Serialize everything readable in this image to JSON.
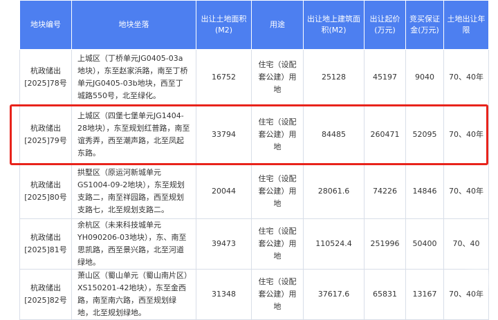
{
  "headers": [
    "地块编号",
    "地块坐落",
    "出让土地面积(M2)",
    "用途",
    "出让地上建筑面积(M2)",
    "出让起价(万元)",
    "竞买保证金(万元)",
    "土地出让年限"
  ],
  "rows": [
    {
      "id": "杭政储出[2025]78号",
      "location": "上城区（丁桥单元JG0405-03a地块），东至赵家浜路，南至丁桥单元JG0405-03b地块，西至丁城路550号，北至绿化。",
      "area": "16752",
      "usage": "住宅（设配套公建）用地",
      "building_area": "25128",
      "start_price": "45197",
      "deposit": "9040",
      "term": "70、40年"
    },
    {
      "id": "杭政储出[2025]79号",
      "location": "上城区（四堡七堡单元JG1404-28地块），东至规划红普路，南至谊秀弄，西至潮声路，北至凤起东路。",
      "area": "33794",
      "usage": "住宅（设配套公建）用地",
      "building_area": "84485",
      "start_price": "260471",
      "deposit": "52095",
      "term": "70、40年"
    },
    {
      "id": "杭政储出[2025]80号",
      "location": "拱墅区（原运河新城单元GS1004-09-2地块），东至规划支路二，南至祥园路，西至规划支路七，北至规划支路二。",
      "area": "20044",
      "usage": "住宅（设配套公建）用地",
      "building_area": "28061.6",
      "start_price": "74226",
      "deposit": "14846",
      "term": "70、40年"
    },
    {
      "id": "杭政储出[2025]81号",
      "location": "余杭区（未来科技城单元YH090206-03地块），东、南至思凯路，西至景兴路，北至河道绿地。",
      "area": "39473",
      "usage": "住宅（设配套公建）用地",
      "building_area": "110524.4",
      "start_price": "251996",
      "deposit": "50400",
      "term": "70、40"
    },
    {
      "id": "杭政储出[2025]82号",
      "location": "萧山区（蜀山单元（蜀山南片区）XS150201-42地块），东至金西路，南至南六路，西至规划绿地，北至规划绿地。",
      "area": "31348",
      "usage": "住宅（设配套公建）用地",
      "building_area": "37617.6",
      "start_price": "65831",
      "deposit": "13167",
      "term": "70、40年"
    }
  ],
  "colors": {
    "header_bg": "#4d7ff0",
    "highlight": "#e8231b"
  }
}
